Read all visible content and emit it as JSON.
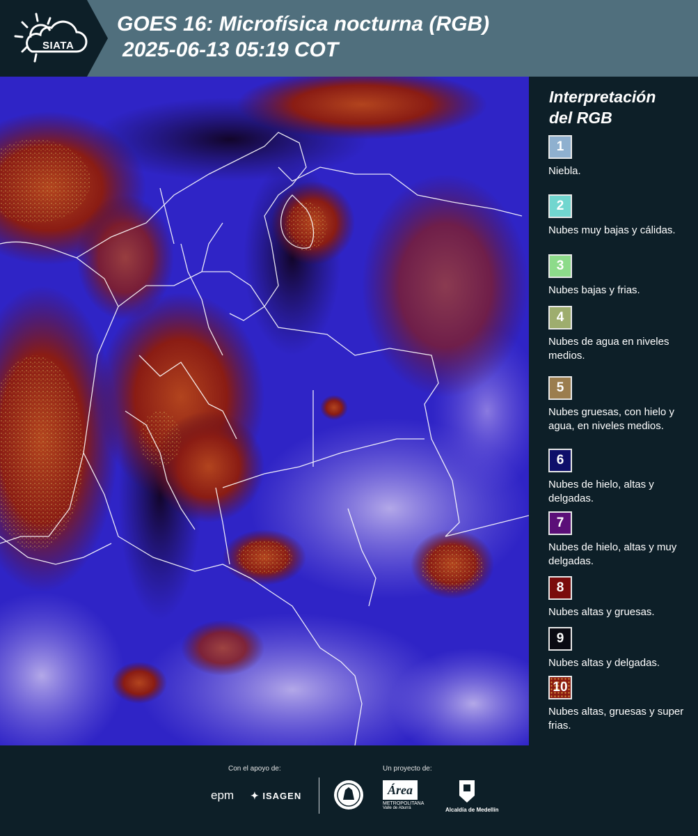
{
  "header": {
    "logo_text": "SIATA",
    "title_line1": "GOES 16: Microfísica nocturna (RGB)",
    "title_line2": "2025-06-13 05:19 COT"
  },
  "legend": {
    "title_line1": "Interpretación",
    "title_line2": "del RGB",
    "items": [
      {
        "num": "1",
        "color": "#8fb0cf",
        "desc": "Niebla."
      },
      {
        "num": "2",
        "color": "#71d6cf",
        "desc": "Nubes muy bajas y cálidas."
      },
      {
        "num": "3",
        "color": "#8ddb8a",
        "desc": "Nubes bajas y frias."
      },
      {
        "num": "4",
        "color": "#9ead6e",
        "desc": "Nubes de agua en niveles medios."
      },
      {
        "num": "5",
        "color": "#9b7d4e",
        "desc": "Nubes gruesas, con hielo y agua, en niveles medios."
      },
      {
        "num": "6",
        "color": "#0e0f6a",
        "desc": "Nubes de hielo, altas y delgadas."
      },
      {
        "num": "7",
        "color": "#5b0f78",
        "desc": "Nubes de hielo, altas y muy delgadas."
      },
      {
        "num": "8",
        "color": "#7a0c0c",
        "desc": "Nubes altas y gruesas."
      },
      {
        "num": "9",
        "color": "#0a0a12",
        "desc": "Nubes altas y delgadas."
      },
      {
        "num": "10",
        "color": "#8c1a10",
        "desc": "Nubes altas, gruesas y super frias."
      }
    ]
  },
  "footer": {
    "support_label": "Con el apoyo de:",
    "project_label": "Un proyecto de:",
    "epm": "epm",
    "isagen": "ISAGEN",
    "area_name": "Área",
    "area_sub1": "METROPOLITANA",
    "area_sub2": "Valle de Aburrá",
    "medellin": "Alcaldía de Medellín",
    "udea": "UdeA"
  }
}
